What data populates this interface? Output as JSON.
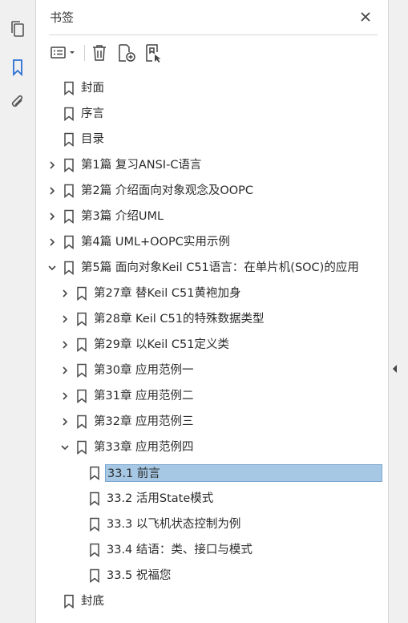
{
  "panel": {
    "title": "书签"
  },
  "rail": {
    "items": [
      {
        "icon": "pages-icon"
      },
      {
        "icon": "bookmark-icon",
        "active": true
      },
      {
        "icon": "attachment-icon"
      }
    ]
  },
  "toolbar": {
    "items": [
      "options-dropdown-icon",
      "delete-icon",
      "new-bookmark-icon",
      "new-bookmark-from-structure-icon"
    ]
  },
  "colors": {
    "accent": "#2d6fd4",
    "selection_bg": "#a6c8e4",
    "selection_border": "#7aa6cf"
  },
  "bookmarks": [
    {
      "level": 0,
      "expander": "none",
      "label": "封面"
    },
    {
      "level": 0,
      "expander": "none",
      "label": "序言"
    },
    {
      "level": 0,
      "expander": "none",
      "label": "目录"
    },
    {
      "level": 0,
      "expander": "collapsed",
      "label": "第1篇 复习ANSI-C语言"
    },
    {
      "level": 0,
      "expander": "collapsed",
      "label": "第2篇 介绍面向对象观念及OOPC"
    },
    {
      "level": 0,
      "expander": "collapsed",
      "label": "第3篇 介绍UML"
    },
    {
      "level": 0,
      "expander": "collapsed",
      "label": "第4篇 UML+OOPC实用示例"
    },
    {
      "level": 0,
      "expander": "expanded",
      "label": "第5篇 面向对象Keil C51语言：在单片机(SOC)的应用"
    },
    {
      "level": 1,
      "expander": "collapsed",
      "label": "第27章 替Keil C51黄袍加身"
    },
    {
      "level": 1,
      "expander": "collapsed",
      "label": "第28章 Keil C51的特殊数据类型"
    },
    {
      "level": 1,
      "expander": "collapsed",
      "label": "第29章 以Keil C51定义类"
    },
    {
      "level": 1,
      "expander": "collapsed",
      "label": "第30章 应用范例一"
    },
    {
      "level": 1,
      "expander": "collapsed",
      "label": "第31章 应用范例二"
    },
    {
      "level": 1,
      "expander": "collapsed",
      "label": "第32章 应用范例三"
    },
    {
      "level": 1,
      "expander": "expanded",
      "label": "第33章 应用范例四"
    },
    {
      "level": 2,
      "expander": "none",
      "label": "33.1 前言",
      "selected": true
    },
    {
      "level": 2,
      "expander": "none",
      "label": "33.2 活用State模式"
    },
    {
      "level": 2,
      "expander": "none",
      "label": "33.3 以飞机状态控制为例"
    },
    {
      "level": 2,
      "expander": "none",
      "label": "33.4 结语：类、接口与模式"
    },
    {
      "level": 2,
      "expander": "none",
      "label": "33.5 祝福您"
    },
    {
      "level": 0,
      "expander": "none",
      "label": "封底"
    }
  ]
}
